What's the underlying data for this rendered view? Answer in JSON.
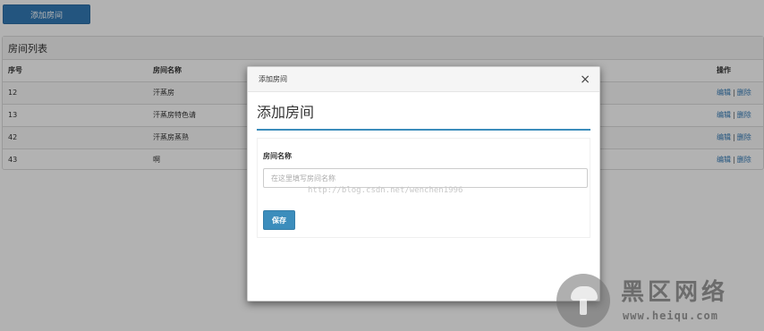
{
  "toolbar": {
    "add_room_label": "添加房间"
  },
  "panel": {
    "title": "房间列表",
    "columns": [
      "序号",
      "房间名称",
      "操作"
    ],
    "rows": [
      {
        "id": "12",
        "name": "汗蒸房"
      },
      {
        "id": "13",
        "name": "汗蒸房特色请"
      },
      {
        "id": "42",
        "name": "汗蒸房蒸熟"
      },
      {
        "id": "43",
        "name": "啊"
      }
    ],
    "edit_label": "编辑",
    "delete_label": "删除",
    "separator": "|"
  },
  "modal": {
    "header_title": "添加房间",
    "close_symbol": "×",
    "heading": "添加房间",
    "field_label": "房间名称",
    "field_placeholder": "在这里填写房间名称",
    "field_value": "",
    "save_label": "保存"
  },
  "watermark": {
    "url": "http://blog.csdn.net/wenchen1996",
    "logo_cn": "黑区网络",
    "logo_en": "www.heiqu.com"
  },
  "colors": {
    "primary": "#337ab7",
    "accent_line": "#3c8dbc",
    "backdrop": "rgba(0,0,0,0.3)"
  }
}
